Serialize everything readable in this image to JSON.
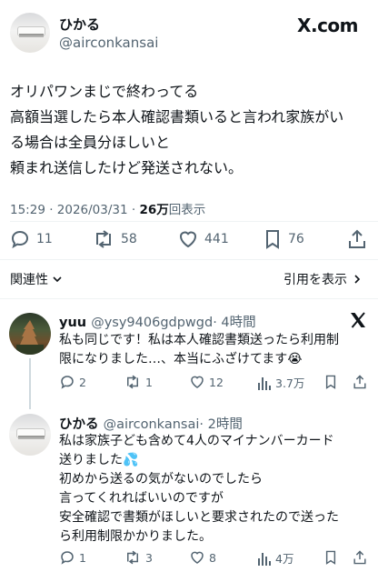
{
  "header": {
    "name": "ひかる",
    "handle": "@airconkansai",
    "brand": "X.com"
  },
  "post": {
    "lines": [
      "オリパワンまじで終わってる",
      "高額当選したら本人確認書類いると言われ家族がい",
      "る場合は全員分ほしいと",
      "頼まれ送信したけど発送されない。"
    ],
    "time": "15:29 · 2026/03/31 · ",
    "views": "26万",
    "views_label": "回表示",
    "actions": {
      "replies": "11",
      "reposts": "58",
      "likes": "441",
      "bookmarks": "76"
    },
    "related_label": "関連性",
    "quotes_label": "引用を表示"
  },
  "replies": [
    {
      "name": "yuu",
      "handle": "@ysy9406gdpwgd",
      "time": "· 4時間",
      "lines": [
        "私も同じです！私は本人確認書類送ったら利用制",
        "限になりました…、本当にふざけてます😭"
      ],
      "actions": {
        "replies": "2",
        "reposts": "1",
        "likes": "12",
        "views": "3.7万"
      }
    },
    {
      "name": "ひかる",
      "handle": "@airconkansai",
      "time": "· 2時間",
      "lines": [
        "私は家族子ども含めて4人のマイナンバーカード",
        "送りました💦",
        "初めから送るの気がないのでしたら",
        "言ってくれればいいのですが",
        "安全確認で書類がほしいと要求されたので送った",
        "ら利用制限かかりました。"
      ],
      "actions": {
        "replies": "1",
        "reposts": "3",
        "likes": "8",
        "views": "4万"
      }
    }
  ],
  "colors": {
    "text": "#0f1419",
    "secondary": "#536471",
    "divider": "#eff3f4"
  }
}
